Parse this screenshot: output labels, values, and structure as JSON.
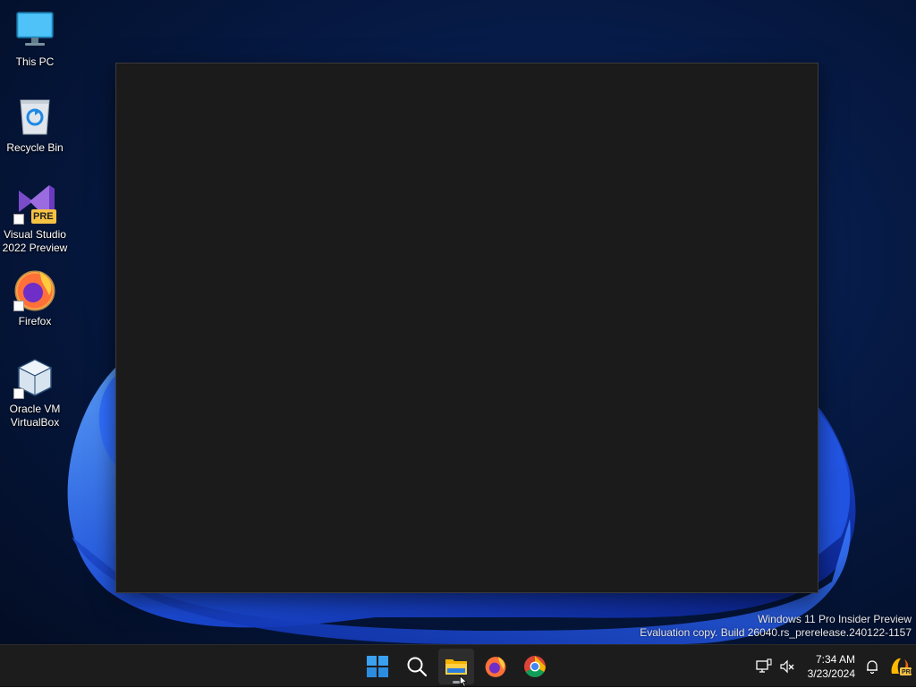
{
  "desktop": {
    "icons": [
      {
        "label": "This PC",
        "icon": "monitor-icon"
      },
      {
        "label": "Recycle Bin",
        "icon": "recycle-bin-icon"
      },
      {
        "label": "Visual Studio\n2022 Preview",
        "icon": "visual-studio-preview-icon",
        "badge": "PRE"
      },
      {
        "label": "Firefox",
        "icon": "firefox-icon"
      },
      {
        "label": "Oracle VM\nVirtualBox",
        "icon": "virtualbox-icon"
      }
    ],
    "watermark": {
      "line1": "Windows 11 Pro Insider Preview",
      "line2": "Evaluation copy. Build 26040.rs_prerelease.240122-1157"
    }
  },
  "taskbar": {
    "apps": [
      {
        "name": "Start",
        "icon": "windows-start-icon"
      },
      {
        "name": "Search",
        "icon": "search-icon"
      },
      {
        "name": "File Explorer",
        "icon": "file-explorer-icon",
        "active": true
      },
      {
        "name": "Firefox",
        "icon": "firefox-icon"
      },
      {
        "name": "Google Chrome",
        "icon": "chrome-icon"
      }
    ],
    "tray": {
      "time": "7:34 AM",
      "date": "3/23/2024",
      "icons": [
        "network-icon",
        "volume-muted-icon",
        "notification-bell-icon",
        "copilot-preview-icon"
      ],
      "copilot_badge": "PRE"
    }
  },
  "colors": {
    "taskbar_bg": "#1c1c1c",
    "window_bg": "#1b1b1b",
    "accent_blue": "#1f6fff"
  }
}
